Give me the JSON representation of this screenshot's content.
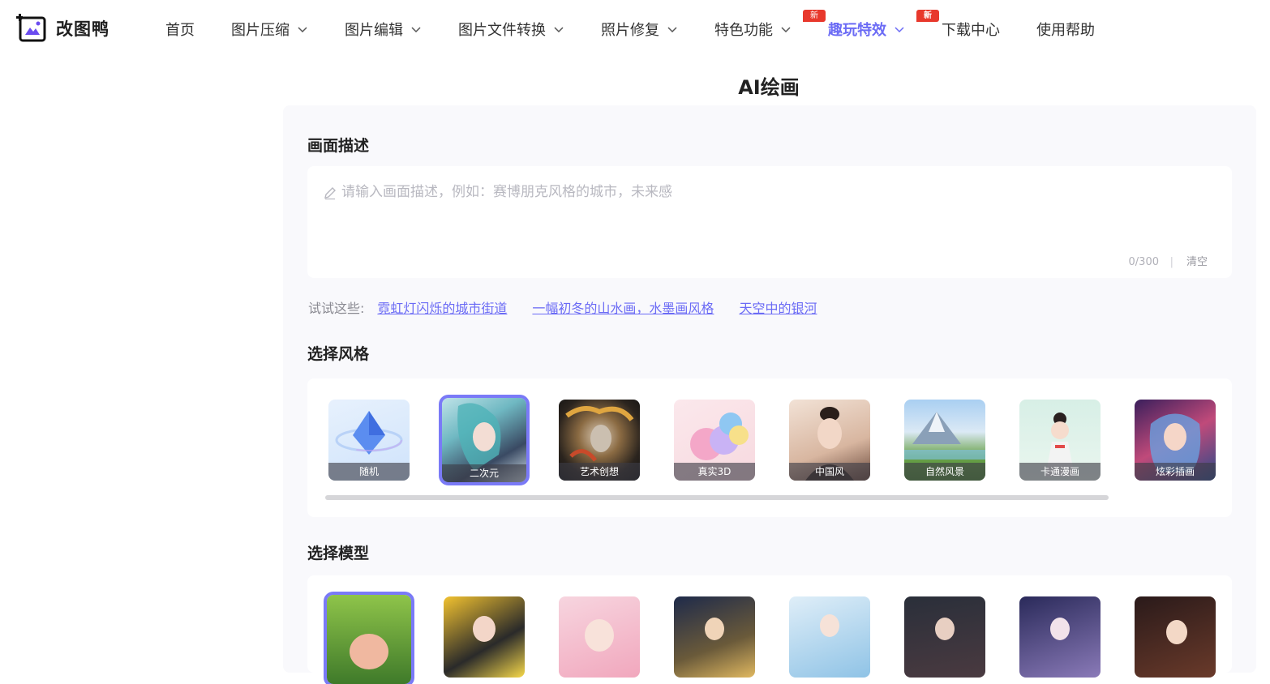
{
  "logo": {
    "text": "改图鸭"
  },
  "nav": [
    {
      "label": "首页",
      "dropdown": false
    },
    {
      "label": "图片压缩",
      "dropdown": true
    },
    {
      "label": "图片编辑",
      "dropdown": true
    },
    {
      "label": "图片文件转换",
      "dropdown": true
    },
    {
      "label": "照片修复",
      "dropdown": true
    },
    {
      "label": "特色功能",
      "dropdown": true,
      "badge": "新"
    },
    {
      "label": "趣玩特效",
      "dropdown": true,
      "badge": "新",
      "active": true
    },
    {
      "label": "下载中心",
      "dropdown": false
    },
    {
      "label": "使用帮助",
      "dropdown": false
    }
  ],
  "page_title": "AI绘画",
  "description": {
    "title": "画面描述",
    "placeholder": "请输入画面描述，例如：赛博朋克风格的城市，未来感",
    "value": "",
    "counter": "0/300",
    "separator": "|",
    "clear_label": "清空"
  },
  "suggestions": {
    "label": "试试这些:",
    "items": [
      "霓虹灯闪烁的城市街道",
      "一幅初冬的山水画，水墨画风格",
      "天空中的银河"
    ]
  },
  "styles": {
    "title": "选择风格",
    "items": [
      {
        "label": "随机",
        "selected": false
      },
      {
        "label": "二次元",
        "selected": true
      },
      {
        "label": "艺术创想",
        "selected": false
      },
      {
        "label": "真实3D",
        "selected": false
      },
      {
        "label": "中国风",
        "selected": false
      },
      {
        "label": "自然风景",
        "selected": false
      },
      {
        "label": "卡通漫画",
        "selected": false
      },
      {
        "label": "炫彩插画",
        "selected": false
      }
    ]
  },
  "models": {
    "title": "选择模型",
    "selected_index": 0,
    "count": 8
  },
  "colors": {
    "accent": "#6b6bf5",
    "badge": "#e8382c",
    "panel": "#f9f9fc"
  }
}
